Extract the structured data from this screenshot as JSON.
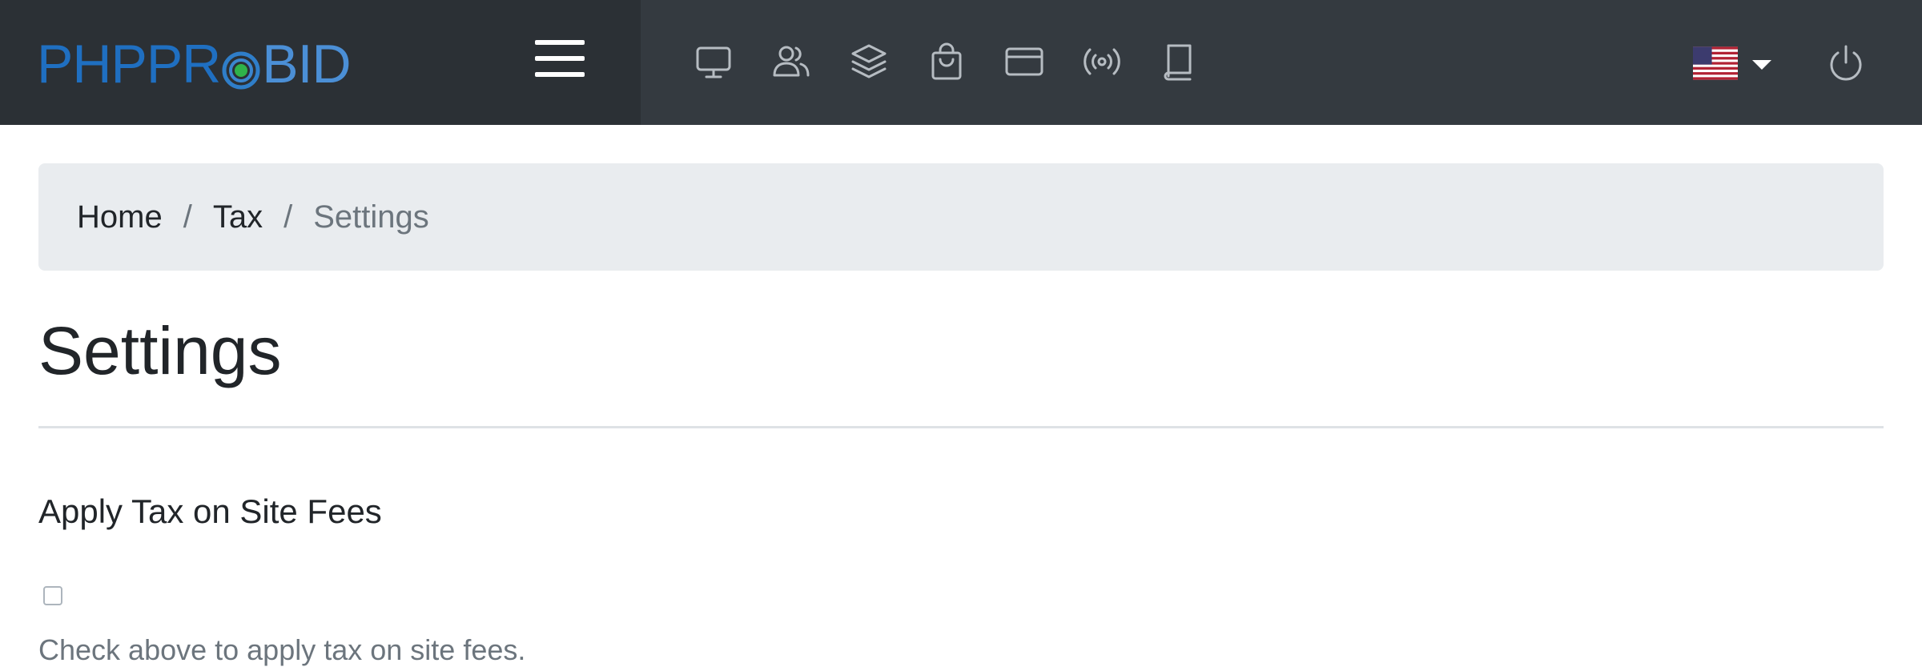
{
  "brand": {
    "logo_part1": "PHPPR",
    "logo_part2": "BID",
    "colors": {
      "blue": "#1f6fc1",
      "light_blue": "#4b8fd6",
      "green": "#2fb34a"
    }
  },
  "topbar": {
    "background": "#343a40",
    "menu_icon": "hamburger-menu-icon",
    "nav_icons": [
      "monitor-icon",
      "users-icon",
      "layers-icon",
      "shopping-bag-icon",
      "credit-card-icon",
      "broadcast-icon",
      "book-icon"
    ],
    "language": {
      "flag": "us-flag-icon",
      "dropdown_icon": "caret-down-icon"
    },
    "power_icon": "power-icon"
  },
  "breadcrumb": {
    "items": [
      "Home",
      "Tax"
    ],
    "separator": "/",
    "active": "Settings"
  },
  "page": {
    "title": "Settings"
  },
  "form": {
    "apply_tax_label": "Apply Tax on Site Fees",
    "apply_tax_checked": false,
    "apply_tax_help": "Check above to apply tax on site fees."
  }
}
